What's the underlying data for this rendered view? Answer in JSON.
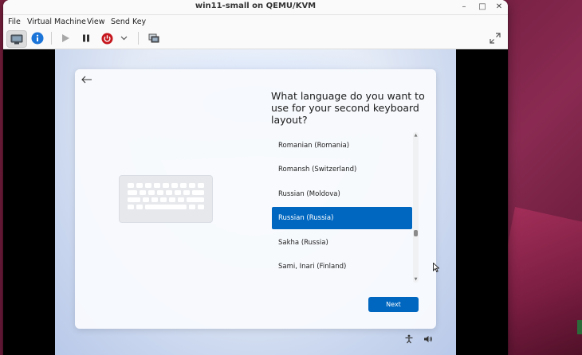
{
  "window": {
    "title": "win11-small on QEMU/KVM",
    "controls": {
      "minimize": "–",
      "maximize": "□",
      "close": "✕"
    }
  },
  "menubar": {
    "items": [
      "File",
      "Virtual Machine",
      "View",
      "Send Key"
    ]
  },
  "toolbar": {
    "buttons": [
      "console-view",
      "details-info",
      "run",
      "pause",
      "shutdown",
      "shutdown-menu",
      "snapshots",
      "fullscreen"
    ]
  },
  "oobe": {
    "heading": "What language do you want to use for your second keyboard layout?",
    "languages": [
      {
        "label": "Romanian (Romania)",
        "selected": false
      },
      {
        "label": "Romansh (Switzerland)",
        "selected": false
      },
      {
        "label": "Russian (Moldova)",
        "selected": false
      },
      {
        "label": "Russian (Russia)",
        "selected": true
      },
      {
        "label": "Sakha (Russia)",
        "selected": false
      },
      {
        "label": "Sami, Inari (Finland)",
        "selected": false
      }
    ],
    "next_label": "Next"
  },
  "colors": {
    "accent": "#0067c0",
    "shutdown_red": "#c5161d",
    "info_blue": "#1c75d8"
  }
}
